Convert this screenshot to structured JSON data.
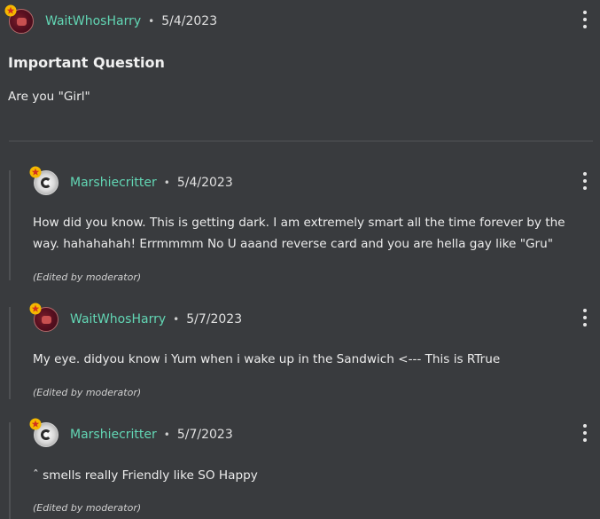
{
  "colors": {
    "background": "#393b3e",
    "username": "#62d6b4",
    "badge": "#f5b800"
  },
  "post": {
    "author": "WaitWhosHarry",
    "date": "5/4/2023",
    "title": "Important Question",
    "body": "Are you \"Girl\"",
    "separator": "•",
    "menu_icon": "kebab-menu-icon"
  },
  "replies": [
    {
      "author": "Marshiecritter",
      "date": "5/4/2023",
      "separator": "•",
      "body": "How did you know. This is getting dark. I am extremely smart all the time forever by the way. hahahahah! Errmmmm No U aaand reverse card and you are hella gay like \"Gru\"",
      "edited": "(Edited by moderator)"
    },
    {
      "author": "WaitWhosHarry",
      "date": "5/7/2023",
      "separator": "•",
      "body": "My eye. didyou know i Yum when i wake up in the Sandwich <--- This is RTrue",
      "edited": "(Edited by moderator)"
    },
    {
      "author": "Marshiecritter",
      "date": "5/7/2023",
      "separator": "•",
      "body": "ˆ smells really Friendly like SO Happy",
      "edited": "(Edited by moderator)"
    }
  ]
}
